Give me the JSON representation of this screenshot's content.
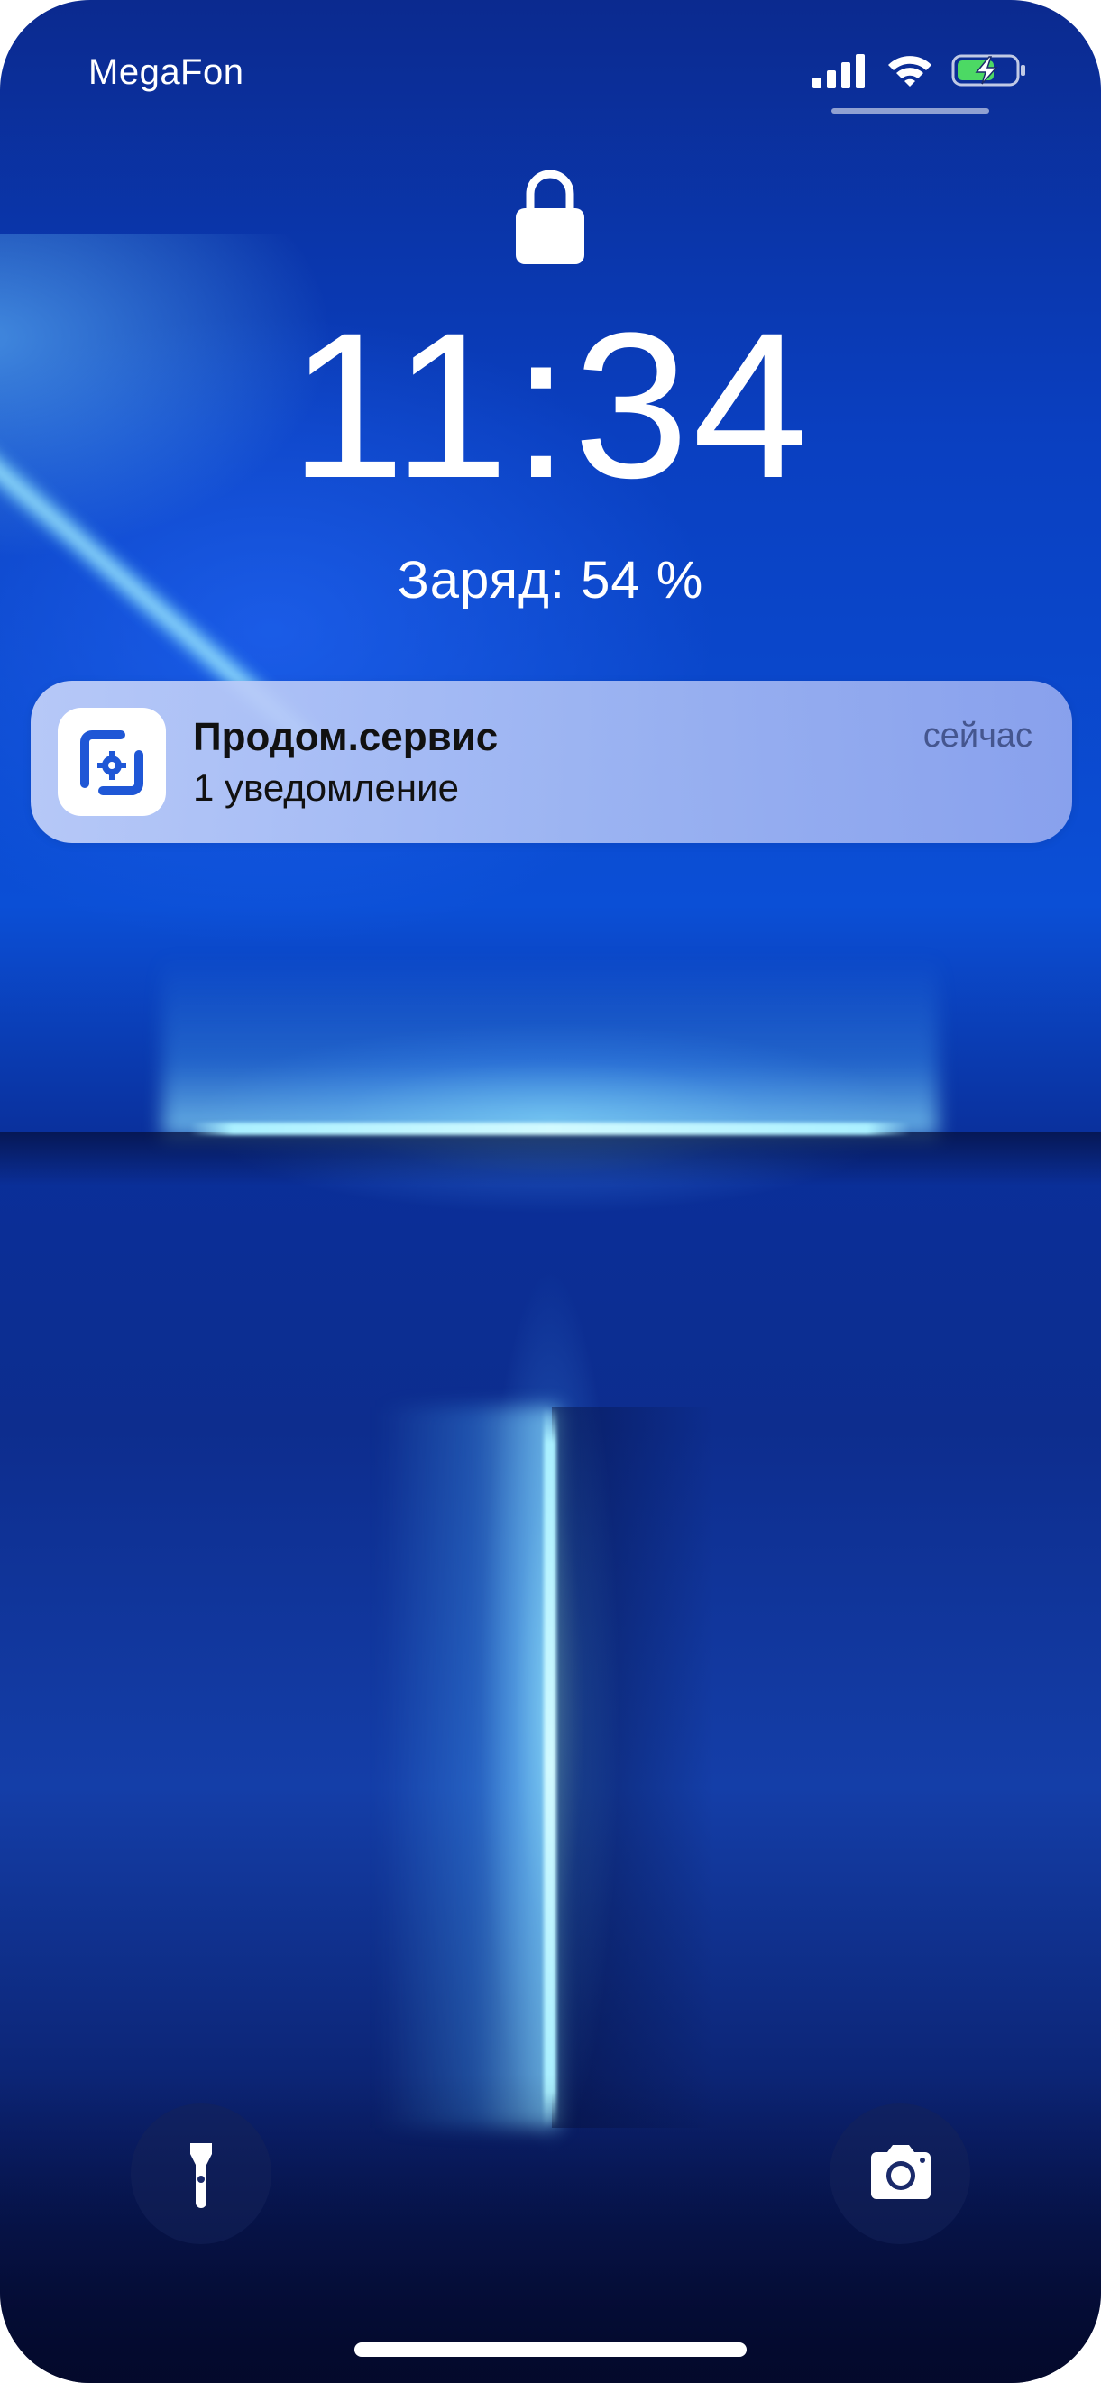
{
  "status_bar": {
    "carrier": "MegaFon",
    "icons": [
      "signal-icon",
      "wifi-icon",
      "battery-charging-icon"
    ]
  },
  "lock_screen": {
    "lock_icon": "lock-icon",
    "time": "11:34",
    "charge_text": "Заряд: 54 %"
  },
  "notification": {
    "app_icon": "app-icon",
    "title": "Продом.сервис",
    "body": "1 уведомление",
    "time": "сейчас"
  },
  "quick_actions": {
    "left": "flashlight-icon",
    "right": "camera-icon"
  },
  "colors": {
    "wallpaper_primary": "#0b4fd6",
    "beam": "#aef0ff",
    "notification_bg": "#c4d2fa",
    "notification_time": "#45568f",
    "battery_fill": "#4cd964",
    "app_icon_blue": "#1f57d6"
  }
}
